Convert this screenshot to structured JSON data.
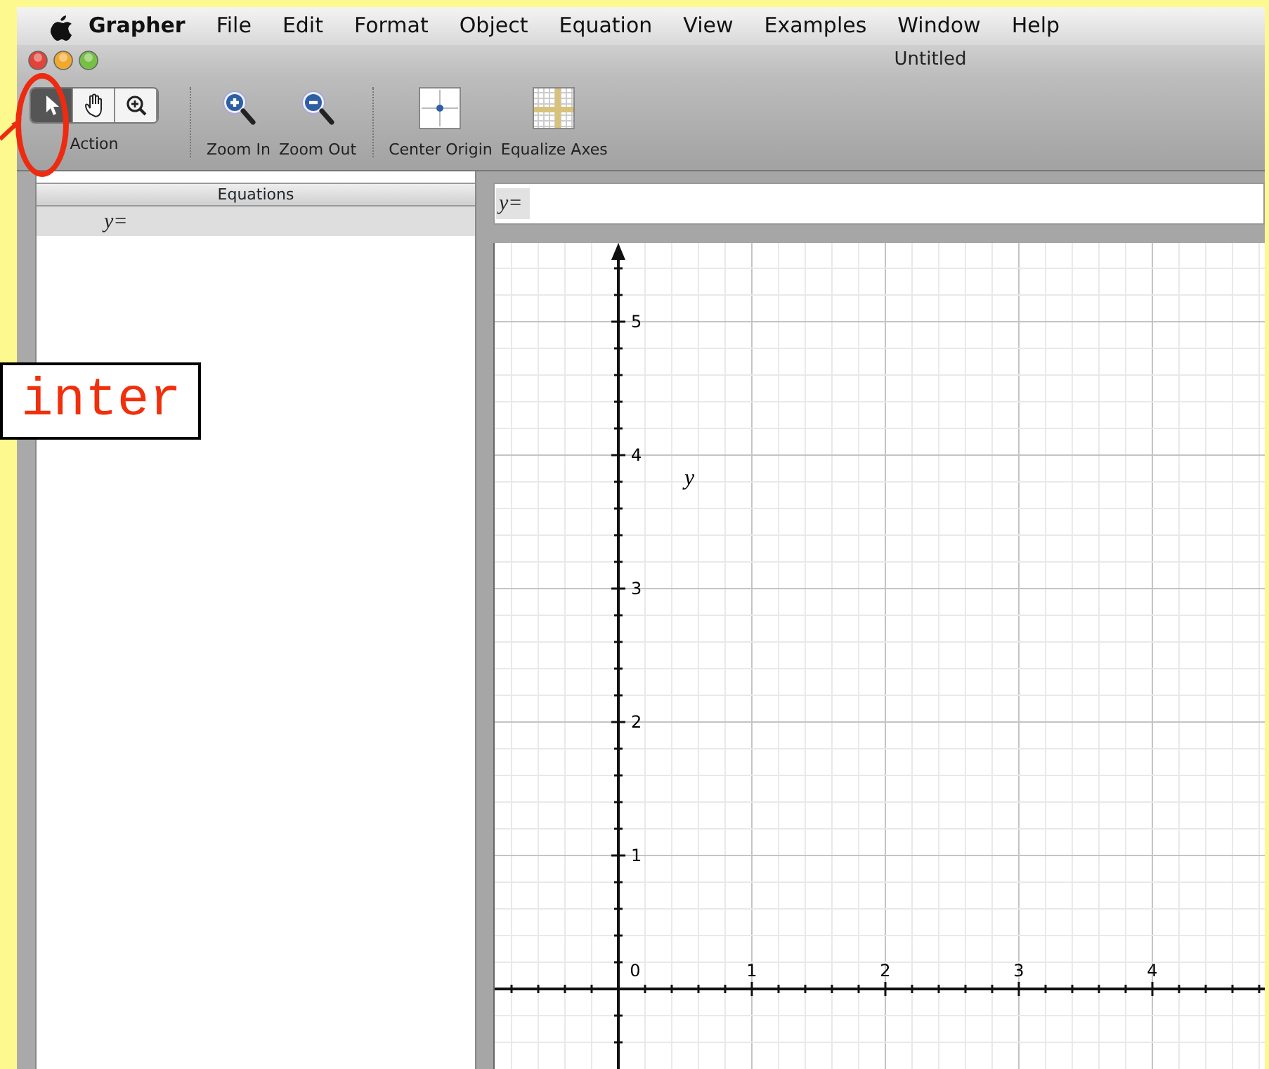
{
  "menu_bar": {
    "items": [
      {
        "kind": "app",
        "label": "Grapher"
      },
      {
        "kind": "menu",
        "label": "File"
      },
      {
        "kind": "menu",
        "label": "Edit"
      },
      {
        "kind": "menu",
        "label": "Format"
      },
      {
        "kind": "menu",
        "label": "Object"
      },
      {
        "kind": "menu",
        "label": "Equation"
      },
      {
        "kind": "menu",
        "label": "View"
      },
      {
        "kind": "menu",
        "label": "Examples"
      },
      {
        "kind": "menu",
        "label": "Window"
      },
      {
        "kind": "menu",
        "label": "Help"
      }
    ]
  },
  "window": {
    "title": "Untitled"
  },
  "toolbar": {
    "tools": [
      {
        "kind": "pointer",
        "selected": true
      },
      {
        "kind": "hand",
        "selected": false
      },
      {
        "kind": "zoom",
        "selected": false
      }
    ],
    "tools_label": "Action",
    "buttons": [
      {
        "kind": "zoom-in",
        "label": "Zoom In"
      },
      {
        "kind": "zoom-out",
        "label": "Zoom Out"
      },
      {
        "kind": "center-origin",
        "label": "Center Origin"
      },
      {
        "kind": "equalize-axes",
        "label": "Equalize Axes"
      }
    ]
  },
  "equations_panel": {
    "header": "Equations",
    "rows": [
      {
        "text": "y=",
        "selected": true
      }
    ]
  },
  "equation_field": {
    "value": "y="
  },
  "graph": {
    "curve_label": "y",
    "x_tick_labels": [
      "0",
      "1",
      "2",
      "3",
      "4"
    ],
    "y_tick_labels": [
      "5",
      "4",
      "3",
      "2",
      "1"
    ]
  },
  "callout": {
    "text": "inter"
  }
}
